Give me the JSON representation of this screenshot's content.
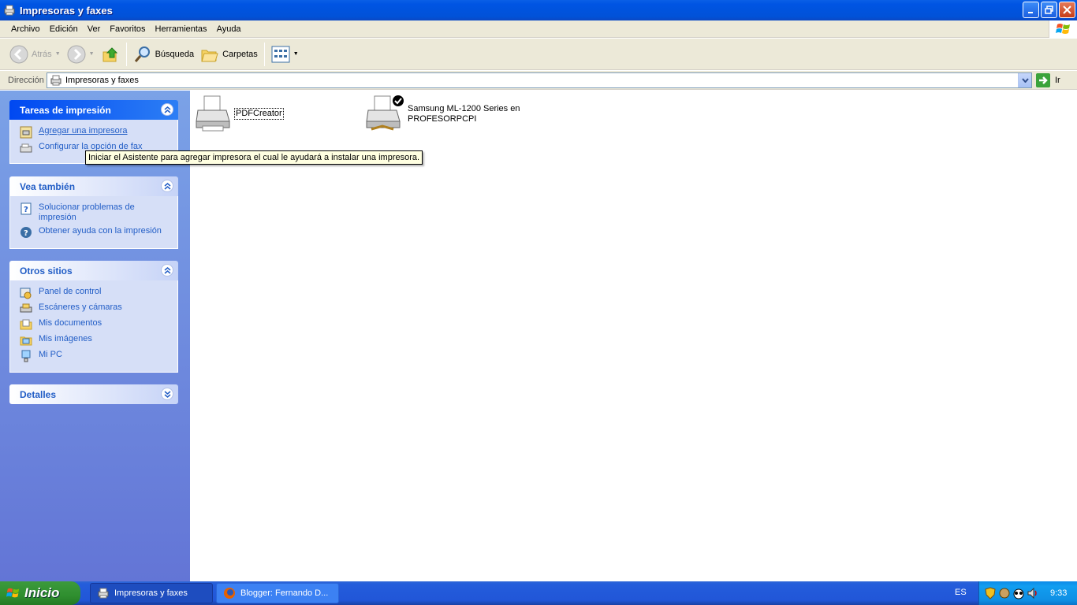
{
  "window": {
    "title": "Impresoras y faxes",
    "menu": [
      "Archivo",
      "Edición",
      "Ver",
      "Favoritos",
      "Herramientas",
      "Ayuda"
    ]
  },
  "toolbar": {
    "back_label": "Atrás",
    "search_label": "Búsqueda",
    "folders_label": "Carpetas"
  },
  "address": {
    "label": "Dirección",
    "value": "Impresoras y faxes",
    "go_label": "Ir"
  },
  "tasks_panel": {
    "title": "Tareas de impresión",
    "items": [
      "Agregar una impresora",
      "Configurar la opción de fax"
    ]
  },
  "see_also_panel": {
    "title": "Vea también",
    "items": [
      "Solucionar problemas de impresión",
      "Obtener ayuda con la impresión"
    ]
  },
  "other_places_panel": {
    "title": "Otros sitios",
    "items": [
      "Panel de control",
      "Escáneres y cámaras",
      "Mis documentos",
      "Mis imágenes",
      "Mi PC"
    ]
  },
  "details_panel": {
    "title": "Detalles"
  },
  "printers": [
    {
      "name": "PDFCreator"
    },
    {
      "name_line1": "Samsung ML-1200 Series en",
      "name_line2": "PROFESORPCPI"
    }
  ],
  "tooltip": "Iniciar el Asistente para agregar impresora el cual le ayudará a instalar una impresora.",
  "taskbar": {
    "start_label": "Inicio",
    "tasks": [
      "Impresoras y faxes",
      "Blogger: Fernando D..."
    ],
    "language": "ES",
    "clock": "9:33"
  }
}
